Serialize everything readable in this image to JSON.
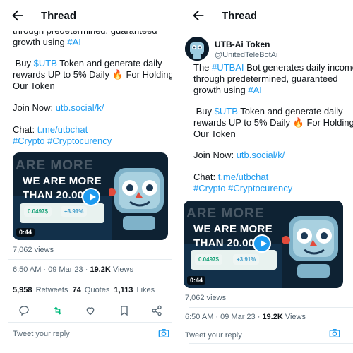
{
  "left": {
    "header": {
      "title": "Thread"
    },
    "lines": [
      "through predetermined, guaranteed",
      "growth using",
      "#AI",
      "Buy",
      "$UTB",
      "Token and generate daily",
      "rewards UP to 5% Daily",
      "For Holding",
      "Our Token",
      "Join Now:",
      "utb.social/k/",
      "Chat:",
      "t.me/utbchat",
      "#Crypto",
      "#Cryptocurency"
    ],
    "media": {
      "ghost_text": "ARE MORE",
      "title_line1": "WE ARE MORE",
      "title_line2": "THAN 20.00",
      "price": "0.0497$",
      "change": "+3.91%",
      "duration": "0:44"
    },
    "views": "7,062 views",
    "timestamp": {
      "time_date": "6:50 AM · 09 Mar 23 · ",
      "count": "19.2K",
      "label": " Views"
    },
    "stats": {
      "retweets_count": "5,958",
      "retweets_label": "Retweets",
      "quotes_count": "74",
      "quotes_label": "Quotes",
      "likes_count": "1,113",
      "likes_label": "Likes"
    },
    "reply_placeholder": "Tweet your reply"
  },
  "right": {
    "header": {
      "title": "Thread"
    },
    "account": {
      "name": "UTB-Ai Token",
      "handle": "@UnitedTeleBotAi"
    },
    "lines": [
      "The",
      "#UTBAI",
      "Bot generates daily income",
      "through predetermined, guaranteed",
      "growth using",
      "#AI",
      "Buy",
      "$UTB",
      "Token and generate daily",
      "rewards UP to 5% Daily",
      "For Holding",
      "Our Token",
      "Join Now:",
      "utb.social/k/",
      "Chat:",
      "t.me/utbchat",
      "#Crypto",
      "#Cryptocurency"
    ],
    "media": {
      "ghost_text": "ARE MORE",
      "title_line1": "WE ARE MORE",
      "title_line2": "THAN 20.00",
      "price": "0.0497$",
      "change": "+3.91%",
      "duration": "0:44"
    },
    "views": "7,062 views",
    "timestamp": {
      "time_date": "6:50 AM · 09 Mar 23 · ",
      "count": "19.2K",
      "label": " Views"
    },
    "reply_placeholder": "Tweet your reply"
  },
  "colors": {
    "link": "#1d9bf0",
    "retweet_active": "#00ba7c",
    "muted": "#536471"
  },
  "icons": [
    "back-arrow-icon",
    "fire-emoji-icon",
    "play-icon",
    "reply-icon",
    "retweet-icon",
    "like-icon",
    "bookmark-icon",
    "share-icon",
    "camera-icon"
  ]
}
